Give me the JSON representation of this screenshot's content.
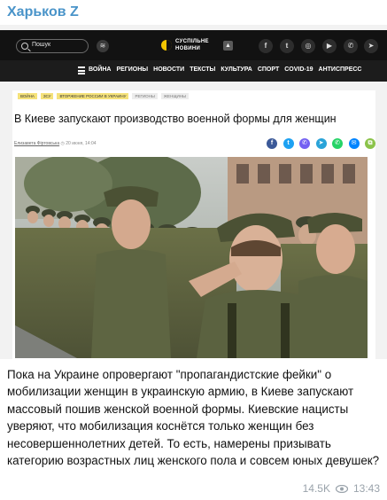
{
  "channel": {
    "name": "Харьков Z"
  },
  "site": {
    "search_placeholder": "Пошук",
    "logo_line1": "СУСПІЛЬНЕ",
    "logo_line2": "НОВИНИ",
    "nav": [
      "ВОЙНА",
      "РЕГИОНЫ",
      "НОВОСТИ",
      "ТЕКСТЫ",
      "КУЛЬТУРА",
      "СПОРТ",
      "COVID-19",
      "АНТИСПРЕСС"
    ],
    "social": [
      {
        "name": "facebook-icon",
        "glyph": "f"
      },
      {
        "name": "twitter-icon",
        "glyph": "t"
      },
      {
        "name": "instagram-icon",
        "glyph": "◎"
      },
      {
        "name": "youtube-icon",
        "glyph": "▶"
      },
      {
        "name": "viber-icon",
        "glyph": "✆"
      },
      {
        "name": "telegram-icon",
        "glyph": "➤"
      }
    ]
  },
  "article": {
    "tags": [
      "ВОЙНА",
      "ЗСУ",
      "ВТОРЖЕНИЕ РОССИИ В УКРАИНУ",
      "РЕГИОНЫ",
      "ЖЕНЩИНЫ"
    ],
    "headline": "В Киеве запускают производство военной формы для женщин",
    "author": "Елизавета Фіртовська",
    "date": "20 июня, 14:04",
    "share": [
      {
        "name": "facebook-share-icon",
        "glyph": "f",
        "color": "#3b5998"
      },
      {
        "name": "twitter-share-icon",
        "glyph": "t",
        "color": "#1da1f2"
      },
      {
        "name": "viber-share-icon",
        "glyph": "✆",
        "color": "#7360f2"
      },
      {
        "name": "telegram-share-icon",
        "glyph": "➤",
        "color": "#2aa3d8"
      },
      {
        "name": "whatsapp-share-icon",
        "glyph": "✆",
        "color": "#25d366"
      },
      {
        "name": "messenger-share-icon",
        "glyph": "✉",
        "color": "#0084ff"
      },
      {
        "name": "copy-link-icon",
        "glyph": "⧉",
        "color": "#8bc34a"
      }
    ]
  },
  "caption": "Пока на Украине опровергают \"пропагандистские фейки\" о мобилизации женщин в украинскую армию, в Киеве запускают массовый пошив женской военной формы. Киевские нацисты уверяют, что мобилизация коснётся только женщин без несовершеннолетних детей. То есть, намерены призывать категорию возрастных лиц женского пола и совсем юных девушек?",
  "views": "14.5K",
  "time": "13:43",
  "colors": {
    "channel_accent": "#4a94c9",
    "logo_yellow": "#f2c500",
    "tag_yellow": "#f5e27a"
  }
}
